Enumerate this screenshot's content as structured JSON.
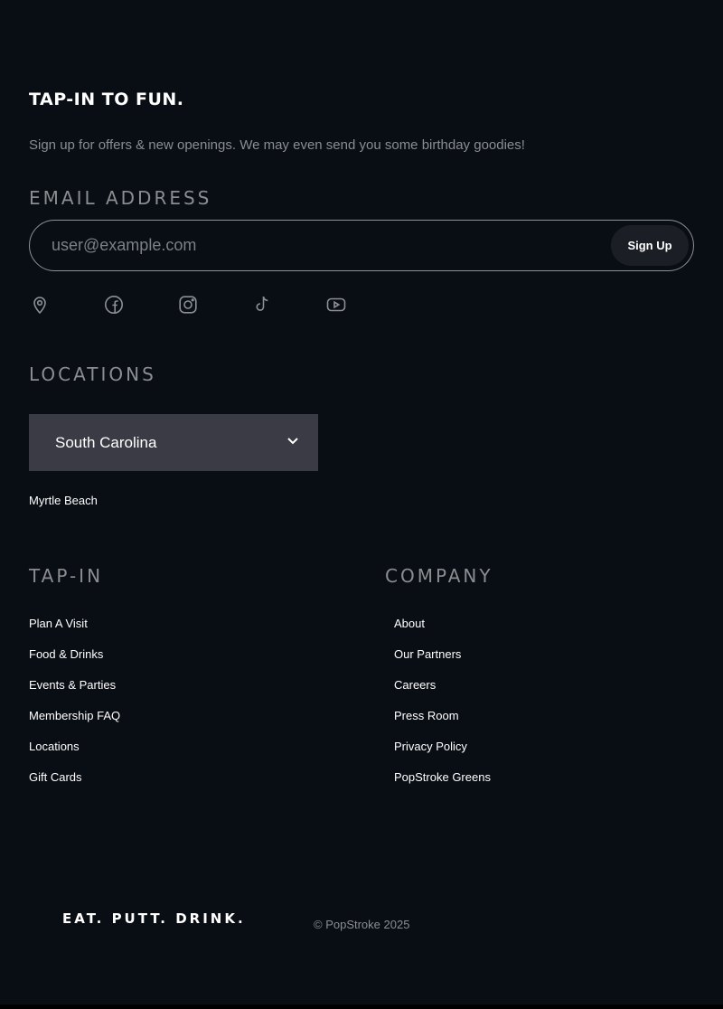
{
  "newsletter": {
    "headline": "TAP-IN TO FUN.",
    "subline": "Sign up for offers & new openings. We may even send you some birthday goodies!",
    "email_label": "EMAIL ADDRESS",
    "email_placeholder": "user@example.com",
    "email_value": "",
    "signup_label": "Sign Up"
  },
  "socials": [
    "location-pin-icon",
    "facebook-icon",
    "instagram-icon",
    "tiktok-icon",
    "youtube-icon"
  ],
  "locations": {
    "label": "LOCATIONS",
    "selected": "South Carolina",
    "cities": [
      "Myrtle Beach"
    ]
  },
  "tap_in": {
    "label": "TAP-IN",
    "links": [
      "Plan A Visit",
      "Food & Drinks",
      "Events & Parties",
      "Membership FAQ",
      "Locations",
      "Gift Cards"
    ]
  },
  "company": {
    "label": "COMPANY",
    "links": [
      "About",
      "Our Partners",
      "Careers",
      "Press Room",
      "Privacy Policy",
      "PopStroke Greens"
    ]
  },
  "footer": {
    "tagline": "EAT. PUTT. DRINK.",
    "copyright": "© PopStroke 2025"
  },
  "colors": {
    "background": "#090d14",
    "muted_text": "#8a8d93",
    "select_bg": "#3a3b44",
    "button_bg": "#1b1e25"
  }
}
